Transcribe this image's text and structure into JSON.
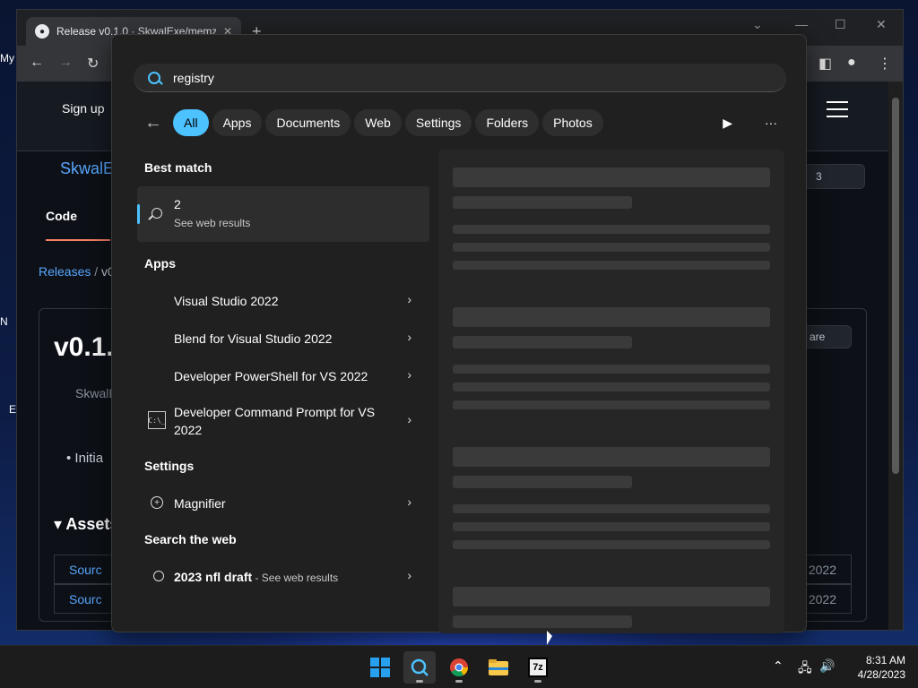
{
  "desktop": {
    "icon_labels": [
      "My",
      "N",
      "E"
    ]
  },
  "browser": {
    "tab_title": "Release v0.1.0 · SkwalExe/memz",
    "favicon": "github-icon",
    "sign_in": "Sign up",
    "repo_name": "SkwalE",
    "code_tab": "Code",
    "breadcrumb_releases": "Releases",
    "breadcrumb_sep": "/",
    "breadcrumb_version": "v0.",
    "release_title": "v0.1.(",
    "release_author": "SkwalE",
    "release_bullet": "Initia",
    "share_label": "are",
    "count_badge": "3",
    "assets_label": "Assets",
    "asset_rows": [
      {
        "name": "Sourc",
        "date": "2022"
      },
      {
        "name": "Sourc",
        "date": "2022"
      }
    ]
  },
  "search": {
    "query": "registry",
    "filters": [
      "All",
      "Apps",
      "Documents",
      "Web",
      "Settings",
      "Folders",
      "Photos"
    ],
    "active_filter": "All",
    "best_match_heading": "Best match",
    "best_match": {
      "title": "2",
      "subtitle": "See web results"
    },
    "apps_heading": "Apps",
    "apps": [
      {
        "label": "Visual Studio 2022"
      },
      {
        "label": "Blend for Visual Studio 2022"
      },
      {
        "label": "Developer PowerShell for VS 2022"
      },
      {
        "label": "Developer Command Prompt for VS 2022"
      }
    ],
    "settings_heading": "Settings",
    "settings": [
      {
        "label": "Magnifier"
      }
    ],
    "web_heading": "Search the web",
    "web": [
      {
        "label": "2023 nfl draft",
        "suffix": " - See web results"
      }
    ]
  },
  "taskbar": {
    "apps": [
      "start-icon",
      "search-icon",
      "chrome-icon",
      "file-explorer-icon",
      "7zip-icon"
    ],
    "zip_label": "7z",
    "time": "8:31 AM",
    "date": "4/28/2023"
  },
  "colors": {
    "accent": "#4cc2ff",
    "panel": "#202020",
    "taskbar": "#1c1c1c"
  }
}
